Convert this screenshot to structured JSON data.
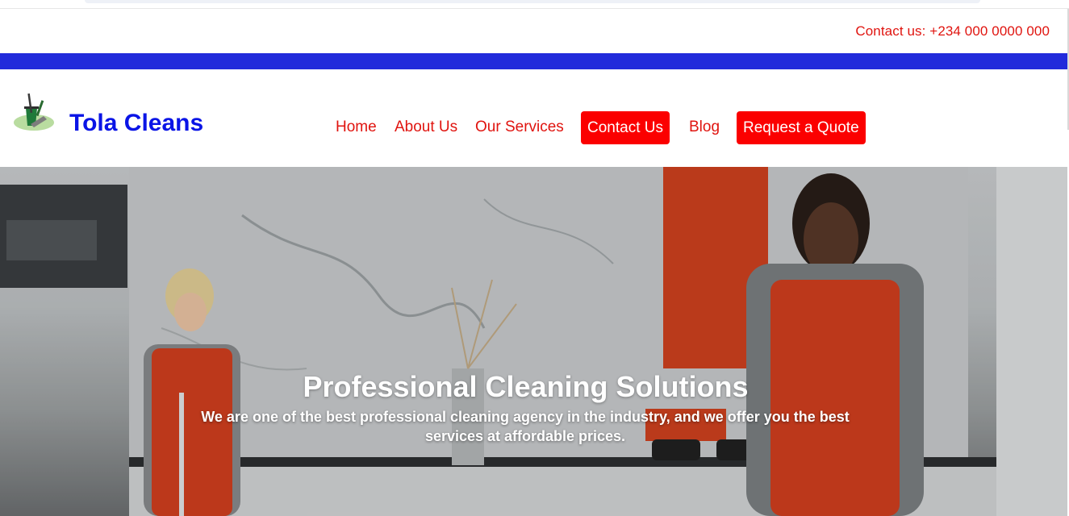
{
  "top_bar": {
    "contact_text": "Contact us: +234 000 0000 000"
  },
  "header": {
    "brand": "Tola Cleans",
    "logo_icon": "cleaning-bucket-icon"
  },
  "nav": {
    "items": [
      {
        "label": "Home"
      },
      {
        "label": "About Us"
      },
      {
        "label": "Our Services"
      },
      {
        "label": "Contact Us"
      },
      {
        "label": "Blog"
      },
      {
        "label": "Request a Quote"
      }
    ]
  },
  "hero": {
    "title": "Professional Cleaning Solutions",
    "subtitle": "We are one of the best professional cleaning agency in the industry, and we offer you the best services at affordable prices."
  },
  "colors": {
    "accent_red": "#fb0000",
    "link_red": "#e0140f",
    "stripe_blue": "#222bdb",
    "brand_blue": "#0a14e6"
  }
}
